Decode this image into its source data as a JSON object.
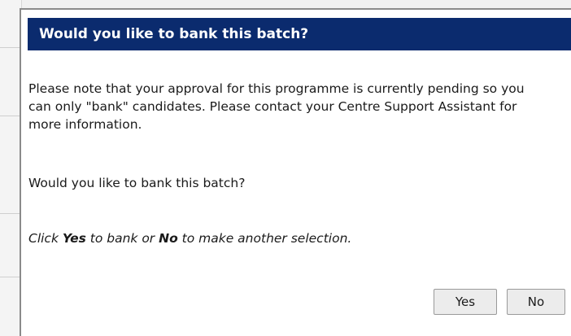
{
  "dialog": {
    "title": "Would you like to bank this batch?",
    "message": "Please note that your approval for this programme is currently pending so you can only \"bank\" candidates. Please contact your Centre Support Assistant for more information.",
    "question": "Would you like to bank this batch?",
    "hint": {
      "prefix": "Click ",
      "yes_word": "Yes",
      "middle": " to bank or ",
      "no_word": "No",
      "suffix": " to make another selection."
    },
    "buttons": {
      "yes_label": "Yes",
      "no_label": "No"
    }
  },
  "colors": {
    "title_bar": "#0b2b6e",
    "title_text": "#ffffff",
    "dialog_background": "#ffffff",
    "button_background": "#ececec"
  }
}
